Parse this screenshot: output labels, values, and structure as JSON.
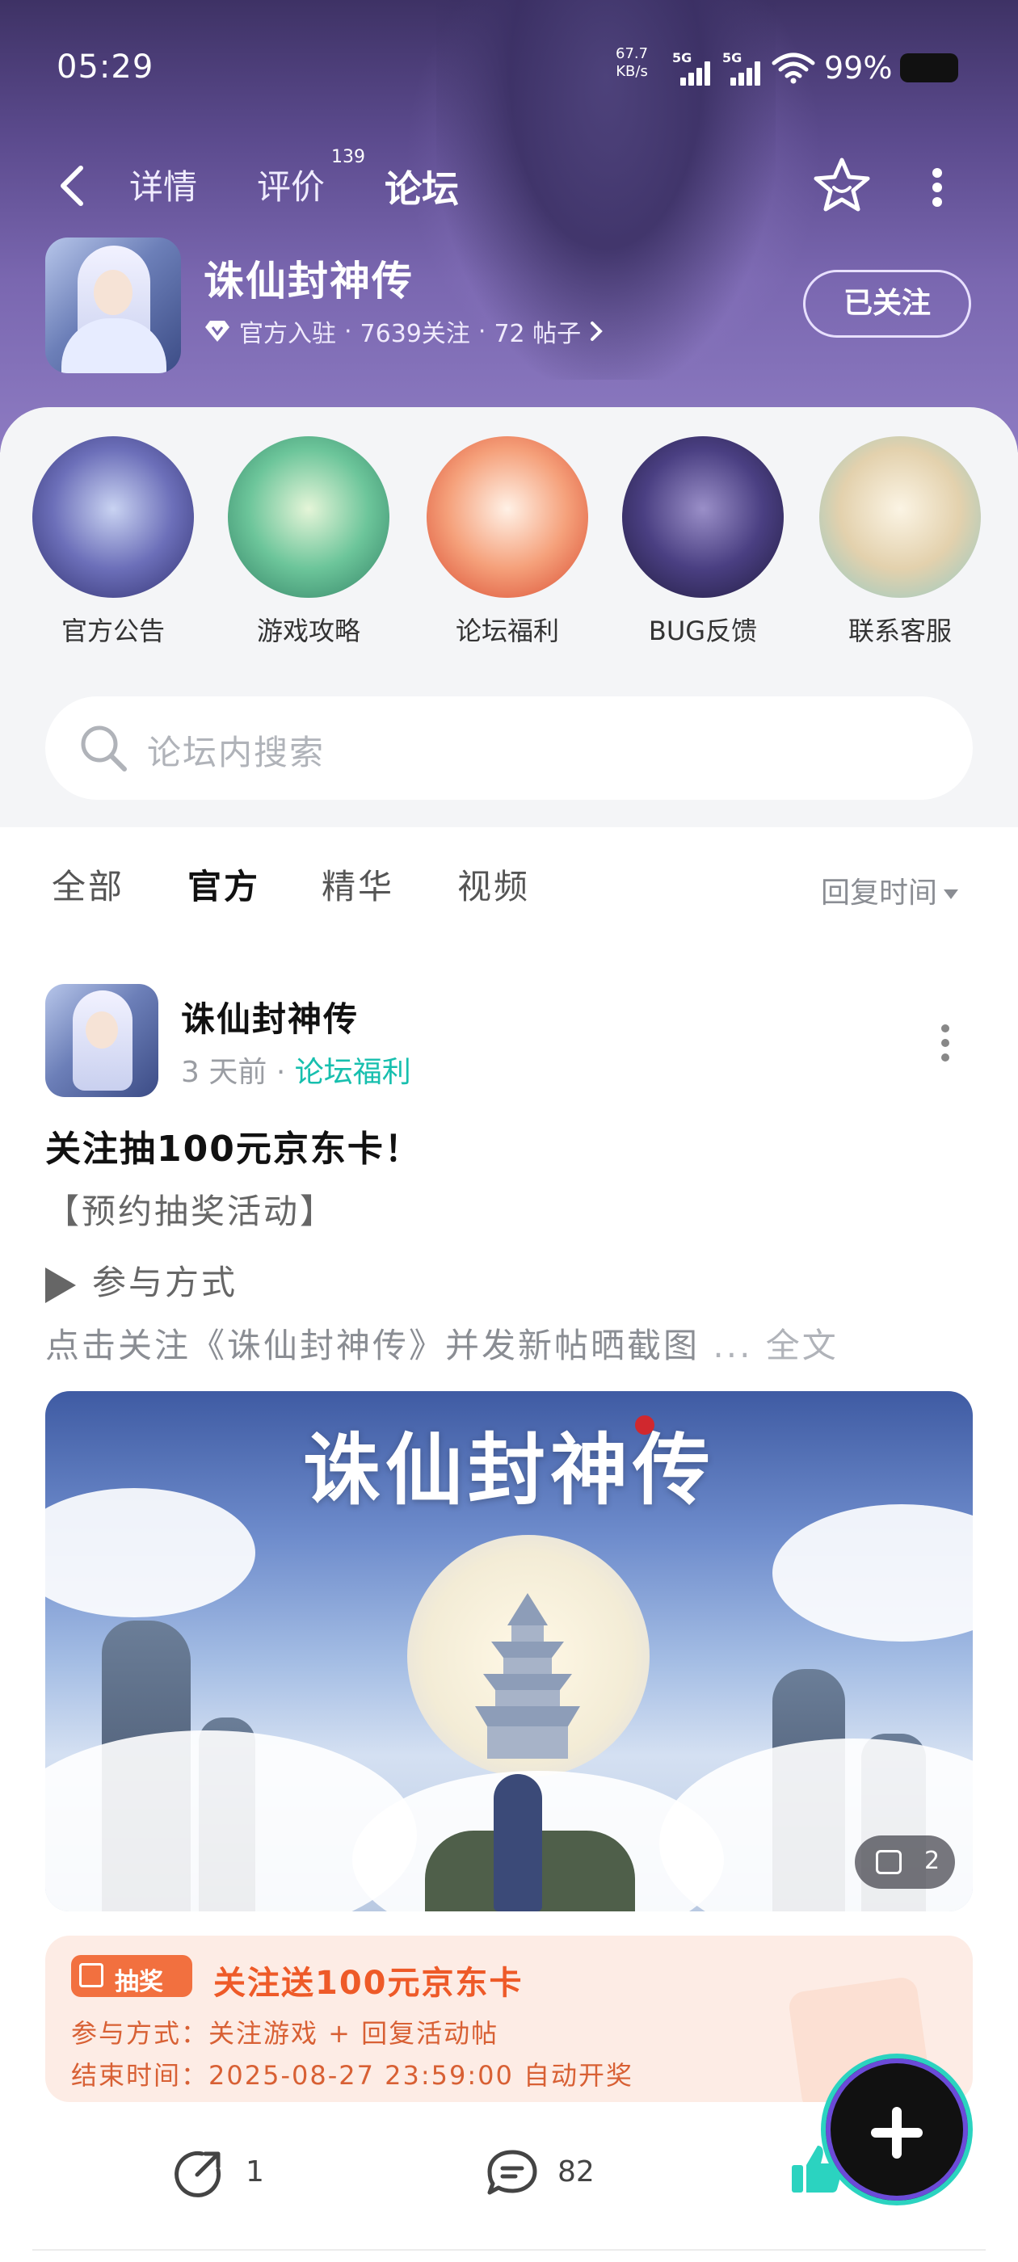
{
  "status_bar": {
    "time": "05:29",
    "net_speed_value": "67.7",
    "net_speed_unit": "KB/s",
    "sim1": "5G",
    "sim2": "5G",
    "battery": "99%"
  },
  "nav": {
    "tabs": [
      {
        "label": "详情"
      },
      {
        "label": "评价",
        "badge": "139"
      },
      {
        "label": "论坛"
      }
    ],
    "active_tab": "论坛"
  },
  "game": {
    "title": "诛仙封神传",
    "official": "官方入驻",
    "followers": "7639关注",
    "posts": "72 帖子",
    "follow_button": "已关注"
  },
  "categories": [
    {
      "label": "官方公告",
      "color": "#4b4f9a"
    },
    {
      "label": "游戏攻略",
      "color": "#3fa58a"
    },
    {
      "label": "论坛福利",
      "color": "#f07d55"
    },
    {
      "label": "BUG反馈",
      "color": "#3b2f6d"
    },
    {
      "label": "联系客服",
      "color": "#d8c9b0"
    }
  ],
  "search": {
    "placeholder": "论坛内搜索"
  },
  "filters": {
    "tabs": [
      "全部",
      "官方",
      "精华",
      "视频"
    ],
    "active": "官方",
    "sort_label": "回复时间"
  },
  "post": {
    "author": "诛仙封神传",
    "time": "3 天前",
    "separator": "·",
    "category": "论坛福利",
    "title": "关注抽100元京东卡！",
    "line1": "【预约抽奖活动】",
    "line2": "参与方式",
    "line3": "点击关注《诛仙封神传》并发新帖晒截图",
    "ellipsis": "...",
    "full_text": "全文",
    "banner_title": "诛仙封神传",
    "image_count": "2",
    "lottery": {
      "tag": "抽奖",
      "title": "关注送100元京东卡",
      "method": "参与方式：关注游戏 + 回复活动帖",
      "end_time": "结束时间：2025-08-27 23:59:00 自动开奖"
    },
    "shares": "1",
    "comments": "82"
  },
  "colors": {
    "accent": "#2bd3c0",
    "link": "#17bfae",
    "lottery_orange": "#ee5a28"
  }
}
